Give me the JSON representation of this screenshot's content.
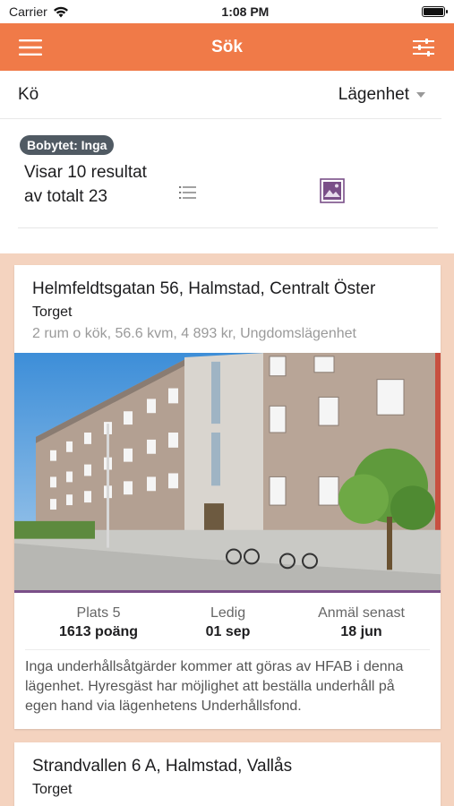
{
  "status_bar": {
    "carrier": "Carrier",
    "time": "1:08 PM"
  },
  "app_bar": {
    "title": "Sök"
  },
  "filter": {
    "queue_label": "Kö",
    "type_selected": "Lägenhet"
  },
  "results": {
    "swap_badge": "Bobytet: Inga",
    "count_text": "Visar 10 resultat av totalt 23"
  },
  "colors": {
    "accent": "#f07a48",
    "list_bg": "#f4d3bf",
    "badge_bg": "#505a63",
    "photo_bar": "#7a4f88"
  },
  "listings": [
    {
      "address": "Helmfeldtsgatan 56, Halmstad, Centralt Öster",
      "area": "Torget",
      "meta": "2 rum o kök, 56.6 kvm, 4 893 kr, Ungdomslägenhet",
      "place_label": "Plats 5",
      "place_value": "1613 poäng",
      "free_label": "Ledig",
      "free_value": "01 sep",
      "deadline_label": "Anmäl senast",
      "deadline_value": "18 jun",
      "description": "Inga underhållsåtgärder kommer att göras av HFAB i denna lägenhet. Hyresgäst har möjlighet att beställa underhåll på egen hand via lägenhetens Underhållsfond."
    },
    {
      "address": "Strandvallen 6 A, Halmstad, Vallås",
      "area": "Torget"
    }
  ]
}
